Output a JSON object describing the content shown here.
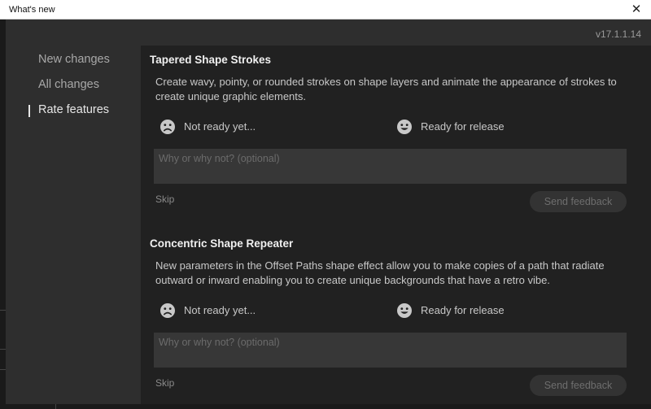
{
  "window": {
    "title": "What's new"
  },
  "version": "v17.1.1.14",
  "nav": {
    "items": [
      {
        "label": "New changes",
        "active": false
      },
      {
        "label": "All changes",
        "active": false
      },
      {
        "label": "Rate features",
        "active": true
      }
    ]
  },
  "features": [
    {
      "title": "Tapered Shape Strokes",
      "description": "Create wavy, pointy, or rounded strokes on shape layers and animate the appearance of strokes to create unique graphic elements.",
      "not_ready_label": "Not ready yet...",
      "ready_label": "Ready for release",
      "feedback_placeholder": "Why or why not? (optional)",
      "skip_label": "Skip",
      "send_label": "Send feedback"
    },
    {
      "title": "Concentric Shape Repeater",
      "description": "New parameters in the Offset Paths shape effect allow you to make copies of a path that radiate outward or inward enabling you to create unique backgrounds that have a retro vibe.",
      "not_ready_label": "Not ready yet...",
      "ready_label": "Ready for release",
      "feedback_placeholder": "Why or why not? (optional)",
      "skip_label": "Skip",
      "send_label": "Send feedback"
    }
  ],
  "colors": {
    "dialog_bg": "#2e2e2e",
    "content_bg": "#212121",
    "input_bg": "#373737",
    "button_bg": "#333333",
    "text": "#c8c8c8"
  },
  "icons": {
    "close": "close-icon",
    "sad": "sad-face-icon",
    "happy": "happy-face-icon"
  }
}
